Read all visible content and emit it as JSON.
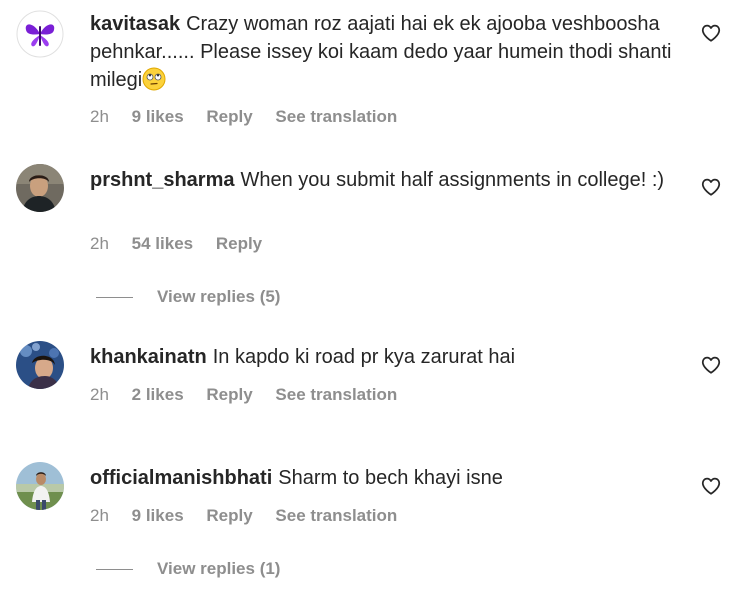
{
  "comments": [
    {
      "username": "kavitasak",
      "text": "Crazy woman roz aajati hai ek ek ajooba veshboosha pehnkar...... Please issey koi kaam dedo yaar humein thodi shanti milegi",
      "emoji": "face-with-rolling-eyes",
      "time": "2h",
      "likes": "9 likes",
      "reply": "Reply",
      "translation": "See translation"
    },
    {
      "username": "prshnt_sharma",
      "text": "When you submit half assignments in college! :)",
      "time": "2h",
      "likes": "54 likes",
      "reply": "Reply",
      "view_replies": "View replies (5)"
    },
    {
      "username": "khankainatn",
      "text": "In kapdo ki road pr kya zarurat hai",
      "time": "2h",
      "likes": "2 likes",
      "reply": "Reply",
      "translation": "See translation"
    },
    {
      "username": "officialmanishbhati",
      "text": "Sharm to bech khayi isne",
      "time": "2h",
      "likes": "9 likes",
      "reply": "Reply",
      "translation": "See translation",
      "view_replies": "View replies (1)"
    }
  ],
  "icons": {
    "like": "heart-outline-icon"
  },
  "colors": {
    "text": "#262626",
    "secondary": "#8e8e8e"
  }
}
